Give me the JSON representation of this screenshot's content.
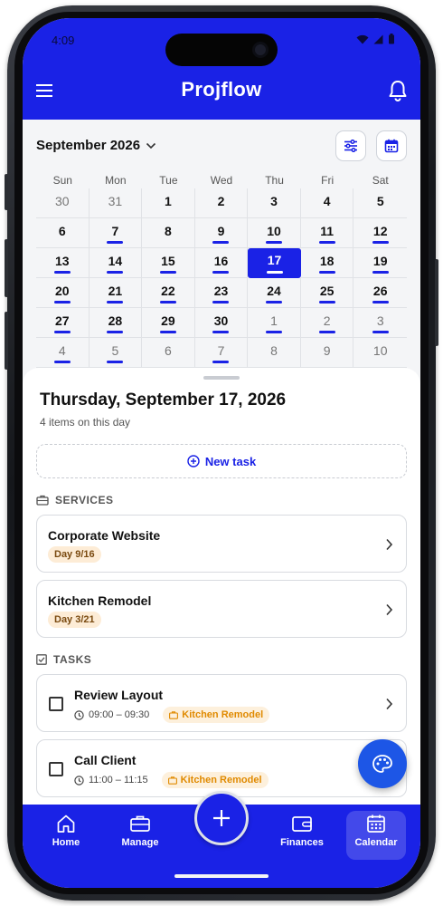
{
  "status": {
    "time": "4:09"
  },
  "app": {
    "title": "Projflow",
    "accent": "#1a22e6"
  },
  "calendar": {
    "month_label": "September 2026",
    "weekdays": [
      "Sun",
      "Mon",
      "Tue",
      "Wed",
      "Thu",
      "Fri",
      "Sat"
    ],
    "selected": "17",
    "days": [
      {
        "n": "30",
        "m": true,
        "d": false
      },
      {
        "n": "31",
        "m": true,
        "d": false
      },
      {
        "n": "1",
        "m": false,
        "d": false
      },
      {
        "n": "2",
        "m": false,
        "d": false
      },
      {
        "n": "3",
        "m": false,
        "d": false
      },
      {
        "n": "4",
        "m": false,
        "d": false
      },
      {
        "n": "5",
        "m": false,
        "d": false
      },
      {
        "n": "6",
        "m": false,
        "d": false
      },
      {
        "n": "7",
        "m": false,
        "d": true
      },
      {
        "n": "8",
        "m": false,
        "d": false
      },
      {
        "n": "9",
        "m": false,
        "d": true
      },
      {
        "n": "10",
        "m": false,
        "d": true
      },
      {
        "n": "11",
        "m": false,
        "d": true
      },
      {
        "n": "12",
        "m": false,
        "d": true
      },
      {
        "n": "13",
        "m": false,
        "d": true
      },
      {
        "n": "14",
        "m": false,
        "d": true
      },
      {
        "n": "15",
        "m": false,
        "d": true
      },
      {
        "n": "16",
        "m": false,
        "d": true
      },
      {
        "n": "17",
        "m": false,
        "d": true
      },
      {
        "n": "18",
        "m": false,
        "d": true
      },
      {
        "n": "19",
        "m": false,
        "d": true
      },
      {
        "n": "20",
        "m": false,
        "d": true
      },
      {
        "n": "21",
        "m": false,
        "d": true
      },
      {
        "n": "22",
        "m": false,
        "d": true
      },
      {
        "n": "23",
        "m": false,
        "d": true
      },
      {
        "n": "24",
        "m": false,
        "d": true
      },
      {
        "n": "25",
        "m": false,
        "d": true
      },
      {
        "n": "26",
        "m": false,
        "d": true
      },
      {
        "n": "27",
        "m": false,
        "d": true
      },
      {
        "n": "28",
        "m": false,
        "d": true
      },
      {
        "n": "29",
        "m": false,
        "d": true
      },
      {
        "n": "30",
        "m": false,
        "d": true
      },
      {
        "n": "1",
        "m": true,
        "d": true
      },
      {
        "n": "2",
        "m": true,
        "d": true
      },
      {
        "n": "3",
        "m": true,
        "d": true
      },
      {
        "n": "4",
        "m": true,
        "d": true
      },
      {
        "n": "5",
        "m": true,
        "d": true
      },
      {
        "n": "6",
        "m": true,
        "d": false
      },
      {
        "n": "7",
        "m": true,
        "d": true
      },
      {
        "n": "8",
        "m": true,
        "d": false
      },
      {
        "n": "9",
        "m": true,
        "d": false
      },
      {
        "n": "10",
        "m": true,
        "d": false
      }
    ]
  },
  "day": {
    "title": "Thursday, September 17, 2026",
    "subtitle": "4 items on this day",
    "new_task_label": "New task"
  },
  "services": {
    "heading": "SERVICES",
    "items": [
      {
        "title": "Corporate Website",
        "chip": "Day 9/16"
      },
      {
        "title": "Kitchen Remodel",
        "chip": "Day 3/21"
      }
    ]
  },
  "tasks": {
    "heading": "TASKS",
    "items": [
      {
        "title": "Review Layout",
        "time": "09:00 – 09:30",
        "project": "Kitchen Remodel"
      },
      {
        "title": "Call Client",
        "time": "11:00 – 11:15",
        "project": "Kitchen Remodel"
      }
    ]
  },
  "nav": {
    "items": [
      "Home",
      "Manage",
      "Finances",
      "Calendar"
    ],
    "active": "Calendar"
  }
}
